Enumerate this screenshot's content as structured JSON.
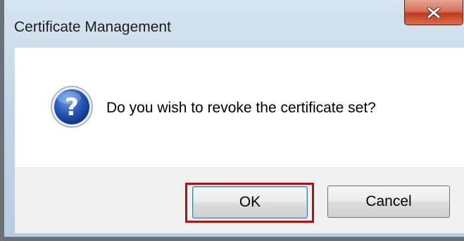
{
  "dialog": {
    "title": "Certificate Management",
    "close_icon": "close-icon",
    "question_icon": "question-icon",
    "message": "Do you wish to revoke the certificate set?",
    "ok_label": "OK",
    "cancel_label": "Cancel"
  },
  "colors": {
    "close_button": "#c23a1c",
    "highlight_border": "#b01018",
    "question_icon_blue": "#1d4fa8"
  }
}
